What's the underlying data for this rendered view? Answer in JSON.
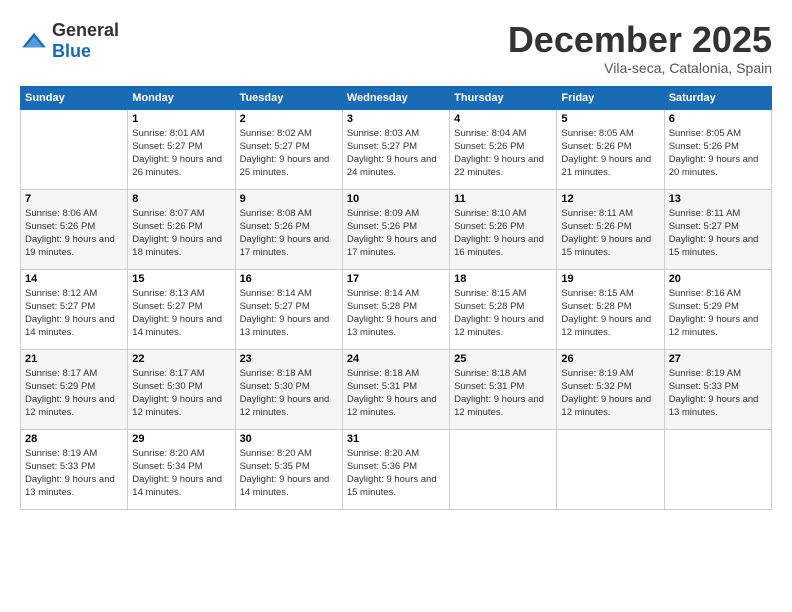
{
  "header": {
    "logo": {
      "text_general": "General",
      "text_blue": "Blue"
    },
    "title": "December 2025",
    "location": "Vila-seca, Catalonia, Spain"
  },
  "weekdays": [
    "Sunday",
    "Monday",
    "Tuesday",
    "Wednesday",
    "Thursday",
    "Friday",
    "Saturday"
  ],
  "weeks": [
    [
      {
        "day": "",
        "sunrise": "",
        "sunset": "",
        "daylight": ""
      },
      {
        "day": "1",
        "sunrise": "Sunrise: 8:01 AM",
        "sunset": "Sunset: 5:27 PM",
        "daylight": "Daylight: 9 hours and 26 minutes."
      },
      {
        "day": "2",
        "sunrise": "Sunrise: 8:02 AM",
        "sunset": "Sunset: 5:27 PM",
        "daylight": "Daylight: 9 hours and 25 minutes."
      },
      {
        "day": "3",
        "sunrise": "Sunrise: 8:03 AM",
        "sunset": "Sunset: 5:27 PM",
        "daylight": "Daylight: 9 hours and 24 minutes."
      },
      {
        "day": "4",
        "sunrise": "Sunrise: 8:04 AM",
        "sunset": "Sunset: 5:26 PM",
        "daylight": "Daylight: 9 hours and 22 minutes."
      },
      {
        "day": "5",
        "sunrise": "Sunrise: 8:05 AM",
        "sunset": "Sunset: 5:26 PM",
        "daylight": "Daylight: 9 hours and 21 minutes."
      },
      {
        "day": "6",
        "sunrise": "Sunrise: 8:05 AM",
        "sunset": "Sunset: 5:26 PM",
        "daylight": "Daylight: 9 hours and 20 minutes."
      }
    ],
    [
      {
        "day": "7",
        "sunrise": "Sunrise: 8:06 AM",
        "sunset": "Sunset: 5:26 PM",
        "daylight": "Daylight: 9 hours and 19 minutes."
      },
      {
        "day": "8",
        "sunrise": "Sunrise: 8:07 AM",
        "sunset": "Sunset: 5:26 PM",
        "daylight": "Daylight: 9 hours and 18 minutes."
      },
      {
        "day": "9",
        "sunrise": "Sunrise: 8:08 AM",
        "sunset": "Sunset: 5:26 PM",
        "daylight": "Daylight: 9 hours and 17 minutes."
      },
      {
        "day": "10",
        "sunrise": "Sunrise: 8:09 AM",
        "sunset": "Sunset: 5:26 PM",
        "daylight": "Daylight: 9 hours and 17 minutes."
      },
      {
        "day": "11",
        "sunrise": "Sunrise: 8:10 AM",
        "sunset": "Sunset: 5:26 PM",
        "daylight": "Daylight: 9 hours and 16 minutes."
      },
      {
        "day": "12",
        "sunrise": "Sunrise: 8:11 AM",
        "sunset": "Sunset: 5:26 PM",
        "daylight": "Daylight: 9 hours and 15 minutes."
      },
      {
        "day": "13",
        "sunrise": "Sunrise: 8:11 AM",
        "sunset": "Sunset: 5:27 PM",
        "daylight": "Daylight: 9 hours and 15 minutes."
      }
    ],
    [
      {
        "day": "14",
        "sunrise": "Sunrise: 8:12 AM",
        "sunset": "Sunset: 5:27 PM",
        "daylight": "Daylight: 9 hours and 14 minutes."
      },
      {
        "day": "15",
        "sunrise": "Sunrise: 8:13 AM",
        "sunset": "Sunset: 5:27 PM",
        "daylight": "Daylight: 9 hours and 14 minutes."
      },
      {
        "day": "16",
        "sunrise": "Sunrise: 8:14 AM",
        "sunset": "Sunset: 5:27 PM",
        "daylight": "Daylight: 9 hours and 13 minutes."
      },
      {
        "day": "17",
        "sunrise": "Sunrise: 8:14 AM",
        "sunset": "Sunset: 5:28 PM",
        "daylight": "Daylight: 9 hours and 13 minutes."
      },
      {
        "day": "18",
        "sunrise": "Sunrise: 8:15 AM",
        "sunset": "Sunset: 5:28 PM",
        "daylight": "Daylight: 9 hours and 12 minutes."
      },
      {
        "day": "19",
        "sunrise": "Sunrise: 8:15 AM",
        "sunset": "Sunset: 5:28 PM",
        "daylight": "Daylight: 9 hours and 12 minutes."
      },
      {
        "day": "20",
        "sunrise": "Sunrise: 8:16 AM",
        "sunset": "Sunset: 5:29 PM",
        "daylight": "Daylight: 9 hours and 12 minutes."
      }
    ],
    [
      {
        "day": "21",
        "sunrise": "Sunrise: 8:17 AM",
        "sunset": "Sunset: 5:29 PM",
        "daylight": "Daylight: 9 hours and 12 minutes."
      },
      {
        "day": "22",
        "sunrise": "Sunrise: 8:17 AM",
        "sunset": "Sunset: 5:30 PM",
        "daylight": "Daylight: 9 hours and 12 minutes."
      },
      {
        "day": "23",
        "sunrise": "Sunrise: 8:18 AM",
        "sunset": "Sunset: 5:30 PM",
        "daylight": "Daylight: 9 hours and 12 minutes."
      },
      {
        "day": "24",
        "sunrise": "Sunrise: 8:18 AM",
        "sunset": "Sunset: 5:31 PM",
        "daylight": "Daylight: 9 hours and 12 minutes."
      },
      {
        "day": "25",
        "sunrise": "Sunrise: 8:18 AM",
        "sunset": "Sunset: 5:31 PM",
        "daylight": "Daylight: 9 hours and 12 minutes."
      },
      {
        "day": "26",
        "sunrise": "Sunrise: 8:19 AM",
        "sunset": "Sunset: 5:32 PM",
        "daylight": "Daylight: 9 hours and 12 minutes."
      },
      {
        "day": "27",
        "sunrise": "Sunrise: 8:19 AM",
        "sunset": "Sunset: 5:33 PM",
        "daylight": "Daylight: 9 hours and 13 minutes."
      }
    ],
    [
      {
        "day": "28",
        "sunrise": "Sunrise: 8:19 AM",
        "sunset": "Sunset: 5:33 PM",
        "daylight": "Daylight: 9 hours and 13 minutes."
      },
      {
        "day": "29",
        "sunrise": "Sunrise: 8:20 AM",
        "sunset": "Sunset: 5:34 PM",
        "daylight": "Daylight: 9 hours and 14 minutes."
      },
      {
        "day": "30",
        "sunrise": "Sunrise: 8:20 AM",
        "sunset": "Sunset: 5:35 PM",
        "daylight": "Daylight: 9 hours and 14 minutes."
      },
      {
        "day": "31",
        "sunrise": "Sunrise: 8:20 AM",
        "sunset": "Sunset: 5:36 PM",
        "daylight": "Daylight: 9 hours and 15 minutes."
      },
      {
        "day": "",
        "sunrise": "",
        "sunset": "",
        "daylight": ""
      },
      {
        "day": "",
        "sunrise": "",
        "sunset": "",
        "daylight": ""
      },
      {
        "day": "",
        "sunrise": "",
        "sunset": "",
        "daylight": ""
      }
    ]
  ]
}
